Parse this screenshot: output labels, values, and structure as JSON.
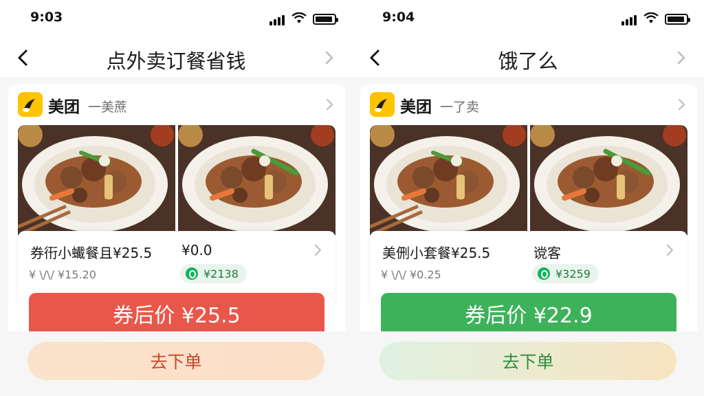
{
  "screens": [
    {
      "status": {
        "time": "9:03"
      },
      "nav": {
        "title": "点外卖订餐省钱"
      },
      "brand": {
        "name": "美团",
        "subtitle": "一美蔗"
      },
      "deal": {
        "title_price": "券衎小蠘餐且¥25.5",
        "value": "¥0.0",
        "strike": "¥ \\/\\/  ¥15.20",
        "coupon_badge": "¥2138",
        "coupon_price": "券后价 ¥25.5"
      },
      "order_button": "去下单",
      "colors": {
        "banner": "#e9574a",
        "button_text": "#c9482c"
      }
    },
    {
      "status": {
        "time": "9:04"
      },
      "nav": {
        "title": "饿了么"
      },
      "brand": {
        "name": "美团",
        "subtitle": "一了卖"
      },
      "deal": {
        "title_price": "美侀小套餐¥25.5",
        "value": "谠客",
        "strike": "¥ \\/\\/  ¥0.25",
        "coupon_badge": "¥3259",
        "coupon_price": "券后价 ¥22.9"
      },
      "order_button": "去下单",
      "colors": {
        "banner": "#3eb25a",
        "button_text": "#2e8d40"
      }
    }
  ],
  "icons": {
    "back": "chevron-left-icon",
    "forward": "chevron-right-icon",
    "signal": "cellular-signal-icon",
    "wifi": "wifi-icon",
    "battery": "battery-icon",
    "brand_logo": "meituan-logo-icon",
    "coupon": "coupon-icon"
  }
}
